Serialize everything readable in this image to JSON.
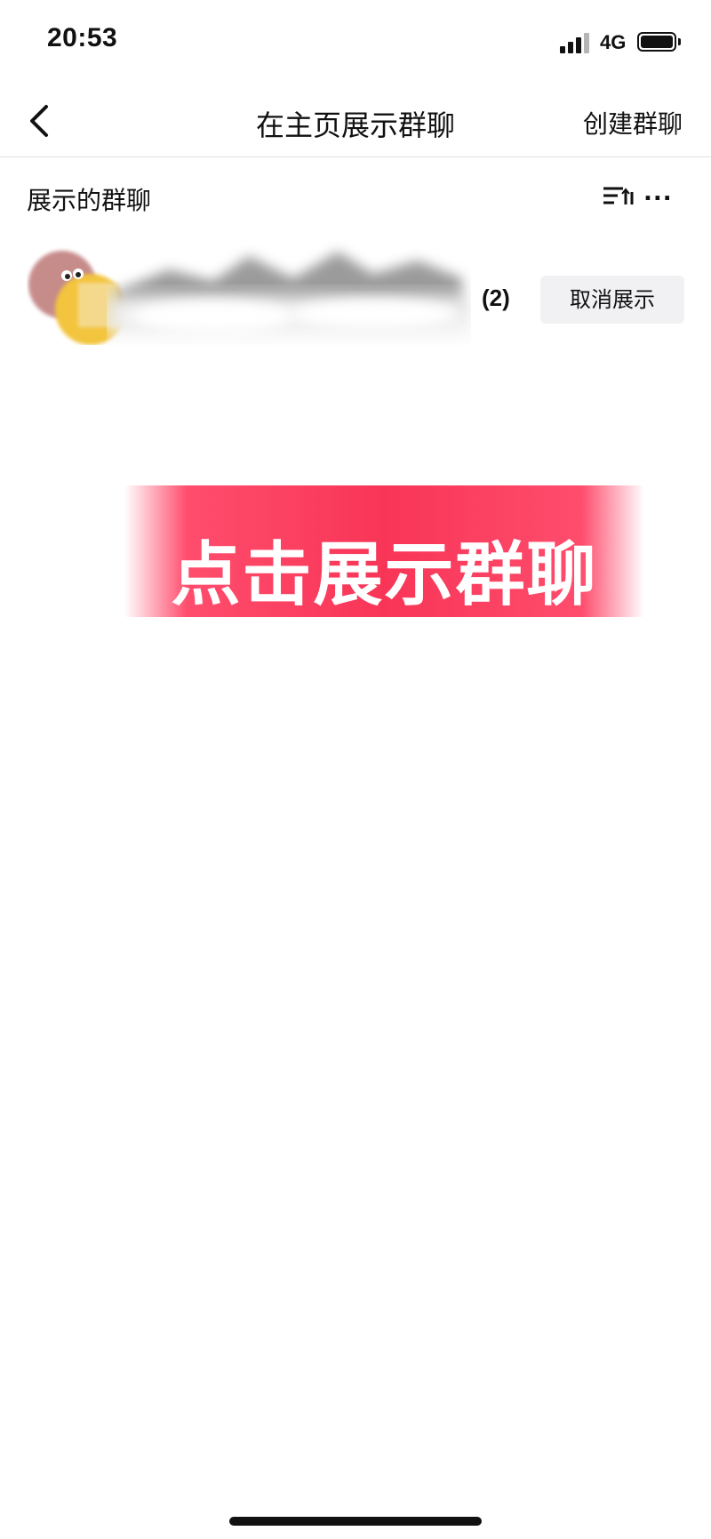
{
  "status_bar": {
    "time": "20:53",
    "network": "4G"
  },
  "nav": {
    "title": "在主页展示群聊",
    "create_label": "创建群聊"
  },
  "section": {
    "title": "展示的群聊",
    "more_label": "..."
  },
  "group": {
    "member_count": "(2)",
    "cancel_label": "取消展示"
  },
  "banner": {
    "text": "点击展示群聊"
  },
  "colors": {
    "banner": "#f83557",
    "button_bg": "#f1f1f3",
    "divider": "#e0e0e0"
  }
}
